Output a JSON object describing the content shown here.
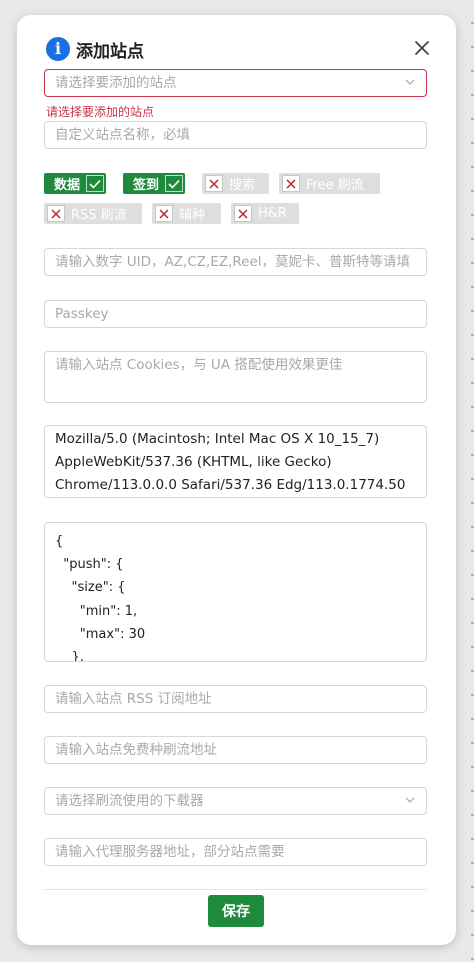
{
  "dialog": {
    "title": "添加站点",
    "site_select_placeholder": "请选择要添加的站点",
    "site_select_error": "请选择要添加的站点",
    "site_name_placeholder": "自定义站点名称，必填",
    "tags": [
      {
        "label": "数据",
        "checked": true
      },
      {
        "label": "签到",
        "checked": true
      },
      {
        "label": "搜索",
        "checked": false
      },
      {
        "label": "Free 刷流",
        "checked": false
      },
      {
        "label": "RSS 刷流",
        "checked": false
      },
      {
        "label": "辅种",
        "checked": false
      },
      {
        "label": "H&R",
        "checked": false
      }
    ],
    "uid_placeholder": "请输入数字 UID，AZ,CZ,EZ,Reel，莫妮卡、普斯特等请填",
    "passkey_placeholder": "Passkey",
    "cookies_placeholder": "请输入站点 Cookies，与 UA 搭配使用效果更佳",
    "user_agent_lines": [
      "Mozilla/5.0 (Macintosh; Intel Mac OS X 10_15_7)",
      "AppleWebKit/537.36 (KHTML, like Gecko)",
      "Chrome/113.0.0.0 Safari/537.36 Edg/113.0.1774.50"
    ],
    "rules_json_lines": [
      "{",
      "  \"push\": {",
      "    \"size\": {",
      "      \"min\": 1,",
      "      \"max\": 30",
      "    },"
    ],
    "rss_placeholder": "请输入站点 RSS 订阅地址",
    "free_rss_placeholder": "请输入站点免费种刷流地址",
    "downloader_placeholder": "请选择刷流使用的下载器",
    "proxy_placeholder": "请输入代理服务器地址，部分站点需要",
    "save_label": "保存"
  },
  "colors": {
    "accent_green": "#1e8a3c",
    "error_red": "#c8344c",
    "info_blue": "#1b6fe0"
  },
  "icons": [
    "info-icon",
    "close-icon",
    "chevron-down-icon",
    "check-icon",
    "x-icon"
  ]
}
